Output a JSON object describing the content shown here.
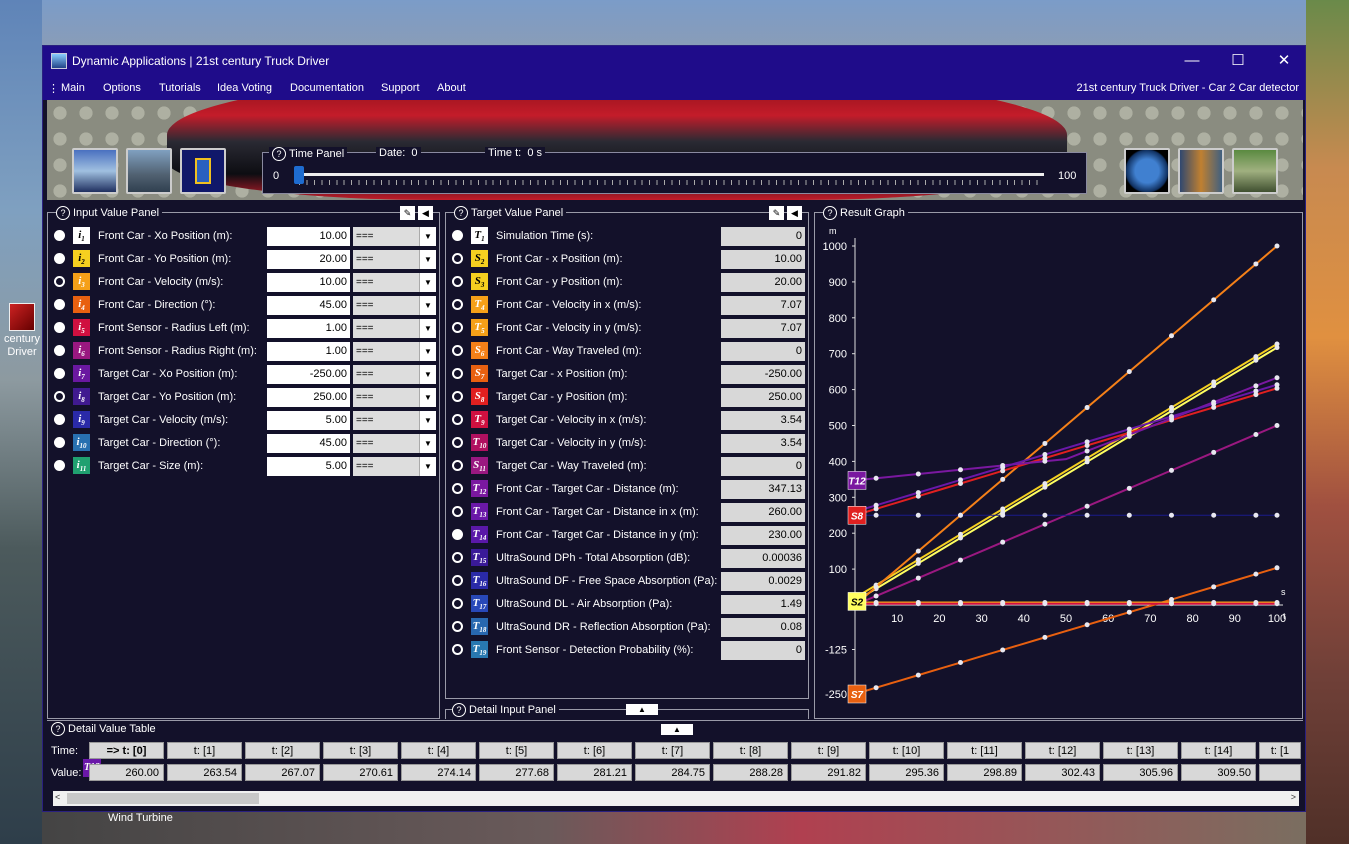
{
  "desktop": {
    "icon_label": "century Driver",
    "icon_label_line1": "century",
    "icon_label_line2": "Driver",
    "bottom_label": "Wind Turbine"
  },
  "window": {
    "title": "Dynamic Applications | 21st century Truck Driver",
    "minimize": "—",
    "maximize": "☐",
    "close": "✕"
  },
  "menu": {
    "items": [
      "Main",
      "Options",
      "Tutorials",
      "Idea Voting",
      "Documentation",
      "Support",
      "About"
    ],
    "right_text": "21st century Truck Driver - Car 2 Car detector"
  },
  "time_panel": {
    "title": "Time Panel",
    "date_label": "Date:",
    "date_value": "0",
    "time_label": "Time t:",
    "time_value": "0 s",
    "min": "0",
    "max": "100",
    "position": 0
  },
  "input_panel": {
    "title": "Input Value Panel",
    "rows": [
      {
        "icon": "i1",
        "icon_color": "#ffffff",
        "label": "Front Car - Xo Position (m):",
        "value": "10.00",
        "op": "===",
        "selected": false
      },
      {
        "icon": "i2",
        "icon_color": "#f5d020",
        "label": "Front Car - Yo Position (m):",
        "value": "20.00",
        "op": "===",
        "selected": false
      },
      {
        "icon": "i3",
        "icon_color": "#f5a018",
        "label": "Front Car - Velocity (m/s):",
        "value": "10.00",
        "op": "===",
        "selected": true
      },
      {
        "icon": "i4",
        "icon_color": "#e86010",
        "label": "Front Car - Direction (°):",
        "value": "45.00",
        "op": "===",
        "selected": false
      },
      {
        "icon": "i5",
        "icon_color": "#d01040",
        "label": "Front Sensor - Radius Left (m):",
        "value": "1.00",
        "op": "===",
        "selected": false
      },
      {
        "icon": "i6",
        "icon_color": "#9a1880",
        "label": "Front Sensor - Radius Right (m):",
        "value": "1.00",
        "op": "===",
        "selected": false
      },
      {
        "icon": "i7",
        "icon_color": "#6a18a0",
        "label": "Target Car - Xo Position (m):",
        "value": "-250.00",
        "op": "===",
        "selected": false
      },
      {
        "icon": "i8",
        "icon_color": "#401a90",
        "label": "Target Car - Yo Position (m):",
        "value": "250.00",
        "op": "===",
        "selected": true
      },
      {
        "icon": "i9",
        "icon_color": "#2a2aa8",
        "label": "Target Car - Velocity (m/s):",
        "value": "5.00",
        "op": "===",
        "selected": false
      },
      {
        "icon": "i10",
        "icon_color": "#2870b0",
        "label": "Target Car - Direction (°):",
        "value": "45.00",
        "op": "===",
        "selected": false
      },
      {
        "icon": "i11",
        "icon_color": "#20a070",
        "label": "Target Car - Size (m):",
        "value": "5.00",
        "op": "===",
        "selected": false
      }
    ]
  },
  "target_panel": {
    "title": "Target Value Panel",
    "rows": [
      {
        "icon": "T1",
        "icon_color": "#ffffff",
        "label": "Simulation Time (s):",
        "value": "0",
        "selected": false
      },
      {
        "icon": "S2",
        "icon_color": "#f5d020",
        "label": "Front Car - x Position (m):",
        "value": "10.00",
        "selected": true
      },
      {
        "icon": "S3",
        "icon_color": "#f5d020",
        "label": "Front Car - y Position (m):",
        "value": "20.00",
        "selected": true
      },
      {
        "icon": "T4",
        "icon_color": "#f5a018",
        "label": "Front Car - Velocity in x (m/s):",
        "value": "7.07",
        "selected": true
      },
      {
        "icon": "T5",
        "icon_color": "#f5a018",
        "label": "Front Car - Velocity in y (m/s):",
        "value": "7.07",
        "selected": true
      },
      {
        "icon": "S6",
        "icon_color": "#f58018",
        "label": "Front Car - Way Traveled (m):",
        "value": "0",
        "selected": true
      },
      {
        "icon": "S7",
        "icon_color": "#e86010",
        "label": "Target Car - x Position (m):",
        "value": "-250.00",
        "selected": true
      },
      {
        "icon": "S8",
        "icon_color": "#e02020",
        "label": "Target Car - y Position (m):",
        "value": "250.00",
        "selected": true
      },
      {
        "icon": "T9",
        "icon_color": "#d01040",
        "label": "Target Car - Velocity in x (m/s):",
        "value": "3.54",
        "selected": true
      },
      {
        "icon": "T10",
        "icon_color": "#b01060",
        "label": "Target Car - Velocity in y (m/s):",
        "value": "3.54",
        "selected": true
      },
      {
        "icon": "S11",
        "icon_color": "#9a1880",
        "label": "Target Car - Way Traveled (m):",
        "value": "0",
        "selected": true
      },
      {
        "icon": "T12",
        "icon_color": "#7a18a0",
        "label": "Front Car - Target Car - Distance (m):",
        "value": "347.13",
        "selected": true
      },
      {
        "icon": "T13",
        "icon_color": "#6a18a8",
        "label": "Front Car - Target Car - Distance in x (m):",
        "value": "260.00",
        "selected": true
      },
      {
        "icon": "T14",
        "icon_color": "#5a18a8",
        "label": "Front Car - Target Car - Distance in y (m):",
        "value": "230.00",
        "selected": false
      },
      {
        "icon": "T15",
        "icon_color": "#3a1a98",
        "label": "UltraSound DPh - Total Absorption (dB):",
        "value": "0.00036",
        "selected": true
      },
      {
        "icon": "T16",
        "icon_color": "#2a2aa8",
        "label": "UltraSound DF - Free Space Absorption (Pa):",
        "value": "0.0029",
        "selected": true
      },
      {
        "icon": "T17",
        "icon_color": "#2848b8",
        "label": "UltraSound DL - Air Absorption (Pa):",
        "value": "1.49",
        "selected": true
      },
      {
        "icon": "T18",
        "icon_color": "#2868b0",
        "label": "UltraSound DR - Reflection Absorption (Pa):",
        "value": "0.08",
        "selected": true
      },
      {
        "icon": "T19",
        "icon_color": "#2878b0",
        "label": "Front Sensor - Detection Probability (%):",
        "value": "0",
        "selected": true
      }
    ]
  },
  "detail_input_panel": {
    "title": "Detail Input Panel"
  },
  "result_graph": {
    "title": "Result Graph",
    "y_unit": "m",
    "x_unit": "s",
    "x_axis_label": "t"
  },
  "chart_data": {
    "type": "line",
    "xlim": [
      0,
      100
    ],
    "ylim": [
      -250,
      1000
    ],
    "x_ticks": [
      10,
      20,
      30,
      40,
      50,
      60,
      70,
      80,
      90,
      100
    ],
    "y_ticks": [
      1000,
      900,
      800,
      700,
      600,
      500,
      400,
      300,
      200,
      100,
      -125,
      -250
    ],
    "x": [
      0,
      5,
      10,
      15,
      20,
      25,
      30,
      35,
      40,
      45,
      50,
      55,
      60,
      65,
      70,
      75,
      80,
      85,
      90,
      95,
      100
    ],
    "series": [
      {
        "name": "S2",
        "color": "#ffff60",
        "values": [
          10,
          45.4,
          80.7,
          116.1,
          151.4,
          186.8,
          222.1,
          257.5,
          292.8,
          328.2,
          363.6,
          398.9,
          434.3,
          469.6,
          505,
          540.3,
          575.7,
          611,
          646.4,
          681.7,
          717.1
        ]
      },
      {
        "name": "S3",
        "color": "#f5d020",
        "values": [
          20,
          55.4,
          90.7,
          126.1,
          161.4,
          196.8,
          232.1,
          267.5,
          302.8,
          338.2,
          373.6,
          408.9,
          444.3,
          479.6,
          515,
          550.3,
          585.7,
          621,
          656.4,
          691.7,
          727.1
        ]
      },
      {
        "name": "S6",
        "color": "#f58018",
        "values": [
          0,
          50,
          100,
          150,
          200,
          250,
          300,
          350,
          400,
          450,
          500,
          550,
          600,
          650,
          700,
          750,
          800,
          850,
          900,
          950,
          1000
        ]
      },
      {
        "name": "S7",
        "color": "#e86010",
        "values": [
          -250,
          -232.3,
          -214.6,
          -197,
          -179.3,
          -161.6,
          -143.9,
          -126.3,
          -108.6,
          -90.9,
          -73.2,
          -55.6,
          -37.9,
          -20.2,
          -2.5,
          15.2,
          32.8,
          50.5,
          68.2,
          85.9,
          103.6
        ]
      },
      {
        "name": "S8",
        "color": "#e02020",
        "values": [
          250,
          267.7,
          285.4,
          303,
          320.7,
          338.4,
          356.1,
          373.7,
          391.4,
          409.1,
          426.8,
          444.4,
          462.1,
          479.8,
          497.5,
          515.2,
          532.8,
          550.5,
          568.2,
          585.9,
          603.6
        ]
      },
      {
        "name": "S11",
        "color": "#9a1880",
        "values": [
          0,
          25,
          50,
          75,
          100,
          125,
          150,
          175,
          200,
          225,
          250,
          275,
          300,
          325,
          350,
          375,
          400,
          425,
          450,
          475,
          500
        ]
      },
      {
        "name": "T12",
        "color": "#7a18a0",
        "values": [
          347.1,
          353,
          358.9,
          364.9,
          370.8,
          376.7,
          382.6,
          388.6,
          394.5,
          400.4,
          406.3,
          429,
          451.6,
          474.3,
          497,
          519.7,
          542.3,
          565,
          587.7,
          610.4,
          633
        ]
      },
      {
        "name": "T13",
        "color": "#6a18a8",
        "values": [
          260,
          277.7,
          295.4,
          313,
          330.7,
          348.4,
          366.1,
          383.7,
          401.4,
          419.1,
          436.8,
          454.4,
          472.1,
          489.8,
          507.5,
          525.2,
          542.8,
          560.5,
          578.2,
          595.9,
          613.6
        ]
      },
      {
        "name": "T14",
        "color": "#1a1a8a",
        "values": [
          250,
          250,
          250,
          250,
          250,
          250,
          250,
          250,
          250,
          250,
          250,
          250,
          250,
          250,
          250,
          250,
          250,
          250,
          250,
          250,
          250
        ]
      },
      {
        "name": "T4",
        "color": "#f5a018",
        "values": [
          7.07,
          7.07,
          7.07,
          7.07,
          7.07,
          7.07,
          7.07,
          7.07,
          7.07,
          7.07,
          7.07,
          7.07,
          7.07,
          7.07,
          7.07,
          7.07,
          7.07,
          7.07,
          7.07,
          7.07,
          7.07
        ]
      },
      {
        "name": "T9",
        "color": "#d01040",
        "values": [
          3.54,
          3.54,
          3.54,
          3.54,
          3.54,
          3.54,
          3.54,
          3.54,
          3.54,
          3.54,
          3.54,
          3.54,
          3.54,
          3.54,
          3.54,
          3.54,
          3.54,
          3.54,
          3.54,
          3.54,
          3.54
        ]
      }
    ],
    "markers": [
      {
        "label": "T12",
        "color": "#7a18a0",
        "value": 347
      },
      {
        "label": "S8",
        "color": "#e02020",
        "value": 250
      },
      {
        "label": "S2",
        "color": "#ffff60",
        "value": 10
      },
      {
        "label": "S7",
        "color": "#e86010",
        "value": -250
      }
    ]
  },
  "detail_table": {
    "title": "Detail Value Table",
    "time_label": "Time:",
    "value_label": "Value:",
    "marker": "T13",
    "times": [
      "=> t: [0]",
      "t: [1]",
      "t: [2]",
      "t: [3]",
      "t: [4]",
      "t: [5]",
      "t: [6]",
      "t: [7]",
      "t: [8]",
      "t: [9]",
      "t: [10]",
      "t: [11]",
      "t: [12]",
      "t: [13]",
      "t: [14]",
      "t: [1"
    ],
    "values": [
      "260.00",
      "263.54",
      "267.07",
      "270.61",
      "274.14",
      "277.68",
      "281.21",
      "284.75",
      "288.28",
      "291.82",
      "295.36",
      "298.89",
      "302.43",
      "305.96",
      "309.50",
      ""
    ]
  }
}
